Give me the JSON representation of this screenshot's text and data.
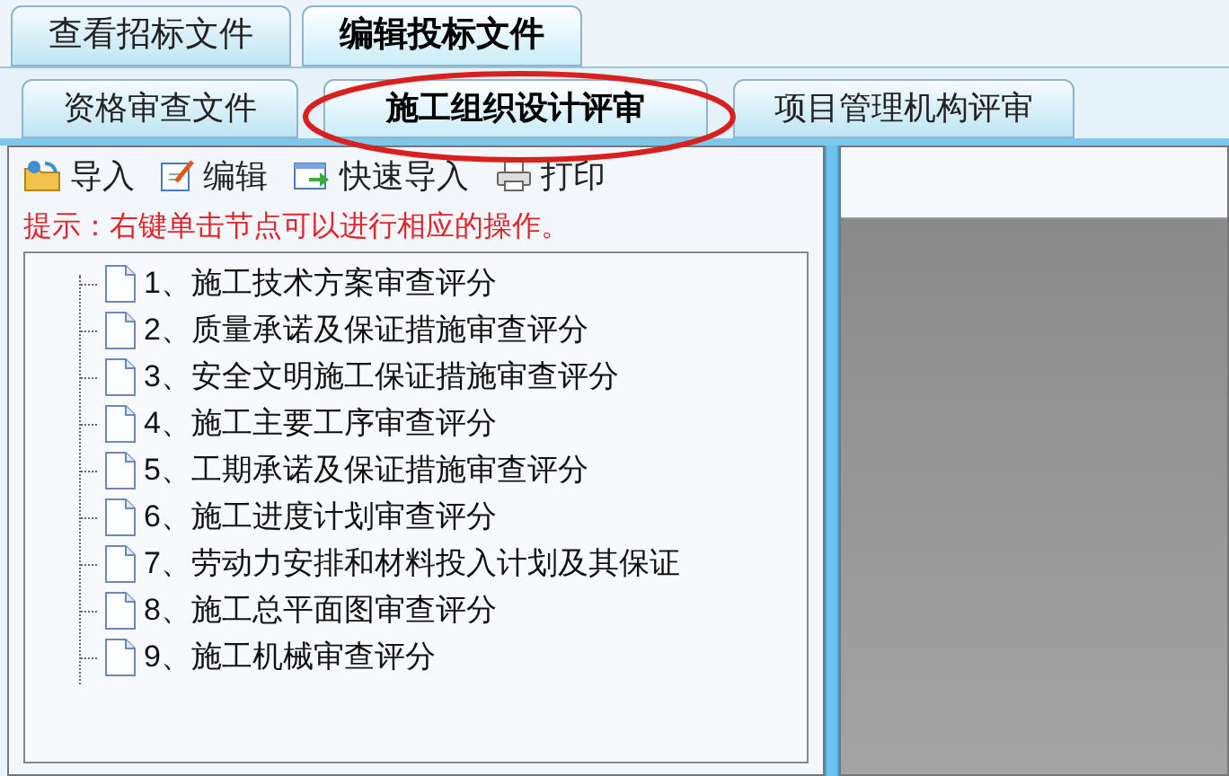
{
  "main_tabs": [
    {
      "label": "查看招标文件",
      "selected": false
    },
    {
      "label": "编辑投标文件",
      "selected": true
    }
  ],
  "sub_tabs": [
    {
      "label": "资格审查文件",
      "selected": false
    },
    {
      "label": "施工组织设计评审",
      "selected": true
    },
    {
      "label": "项目管理机构评审",
      "selected": false
    }
  ],
  "toolbar": [
    {
      "kind": "import",
      "label": "导入"
    },
    {
      "kind": "edit",
      "label": "编辑"
    },
    {
      "kind": "quick-import",
      "label": "快速导入"
    },
    {
      "kind": "print",
      "label": "打印"
    }
  ],
  "hint": "提示：右键单击节点可以进行相应的操作。",
  "tree": {
    "items": [
      {
        "label": "1、施工技术方案审查评分"
      },
      {
        "label": "2、质量承诺及保证措施审查评分"
      },
      {
        "label": "3、安全文明施工保证措施审查评分"
      },
      {
        "label": "4、施工主要工序审查评分"
      },
      {
        "label": "5、工期承诺及保证措施审查评分"
      },
      {
        "label": "6、施工进度计划审查评分"
      },
      {
        "label": "7、劳动力安排和材料投入计划及其保证"
      },
      {
        "label": "8、施工总平面图审查评分"
      },
      {
        "label": "9、施工机械审查评分"
      }
    ]
  }
}
